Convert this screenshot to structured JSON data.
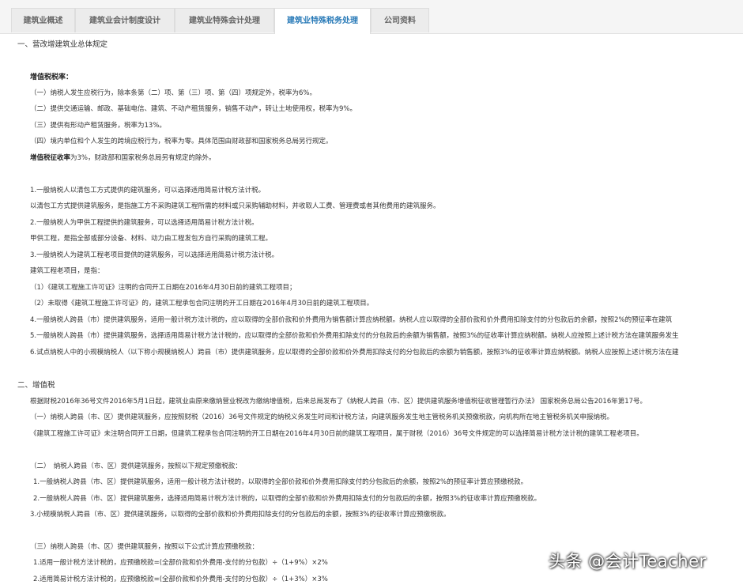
{
  "tabs": [
    {
      "label": "建筑业概述"
    },
    {
      "label": "建筑业会计制度设计"
    },
    {
      "label": "建筑业特殊会计处理"
    },
    {
      "label": "建筑业特殊税务处理"
    },
    {
      "label": "公司资料"
    }
  ],
  "active_tab": "建筑业特殊税务处理",
  "content": {
    "s1_heading": "一、营改增建筑业总体规定",
    "vat_rate_heading": "增值税税率：",
    "vat_rate_items": [
      "（一）纳税人发生应税行为，除本条第（二）项、第（三）项、第（四）项规定外，税率为6%。",
      "（二）提供交通运输、邮政、基础电信、建筑、不动产租赁服务，销售不动产，转让土地使用权，税率为9%。",
      "（三）提供有形动产租赁服务，税率为13%。",
      "（四）境内单位和个人发生的跨境应税行为，税率为零。具体范围由财政部和国家税务总局另行规定。"
    ],
    "levy_rate_bold": "增值税征收率",
    "levy_rate_rest": "为3%，财政部和国家税务总局另有规定的除外。",
    "simple_method_items": [
      "1.一般纳税人以清包工方式提供的建筑服务，可以选择适用简易计税方法计税。",
      "以清包工方式提供建筑服务，是指施工方不采购建筑工程所需的材料或只采购辅助材料，并收取人工费、管理费或者其他费用的建筑服务。",
      "2.一般纳税人为甲供工程提供的建筑服务，可以选择适用简易计税方法计税。",
      "甲供工程，是指全部或部分设备、材料、动力由工程发包方自行采购的建筑工程。",
      "3.一般纳税人为建筑工程老项目提供的建筑服务，可以选择适用简易计税方法计税。",
      "建筑工程老项目，是指：",
      "（1）《建筑工程施工许可证》注明的合同开工日期在2016年4月30日前的建筑工程项目；",
      "（2）未取得《建筑工程施工许可证》的，建筑工程承包合同注明的开工日期在2016年4月30日前的建筑工程项目。",
      "4.一般纳税人跨县（市）提供建筑服务，适用一般计税方法计税的，应以取得的全部价款和价外费用为销售额计算应纳税额。纳税人应以取得的全部价款和价外费用扣除支付的分包款后的余额，按照2%的预征率在建筑",
      "5.一般纳税人跨县（市）提供建筑服务，选择适用简易计税方法计税的，应以取得的全部价款和价外费用扣除支付的分包款后的余额为销售额，按照3%的征收率计算应纳税额。纳税人应按照上述计税方法在建筑服务发生",
      "6.试点纳税人中的小规模纳税人（以下称小规模纳税人）跨县（市）提供建筑服务，应以取得的全部价款和价外费用扣除支付的分包款后的余额为销售额，按照3%的征收率计算应纳税额。纳税人应按照上述计税方法在建"
    ],
    "s2_heading": "二、增值税",
    "s2_intro": "根据财税2016年36号文件2016年5月1日起，建筑业由原来缴纳营业税改为缴纳增值税，后来总局发布了《纳税人跨县（市、区）提供建筑服务增值税征收管理暂行办法》 国家税务总局公告2016年第17号。",
    "s2_p1": "（一）纳税人跨县（市、区）提供建筑服务，应按照财税（2016）36号文件规定的纳税义务发生时间和计税方法，向建筑服务发生地主管税务机关预缴税款，向机构所在地主管税务机关申报纳税。",
    "s2_p2": "《建筑工程施工许可证》未注明合同开工日期，但建筑工程承包合同注明的开工日期在2016年4月30日前的建筑工程项目，属于财税（2016）36号文件规定的可以选择简易计税方法计税的建筑工程老项目。",
    "s2_prepay_heading": "（二）　纳税人跨县（市、区）提供建筑服务，按照以下规定预缴税款：",
    "s2_prepay_items": [
      "1.一般纳税人跨县（市、区）提供建筑服务，适用一般计税方法计税的，以取得的全部价款和价外费用扣除支付的分包款后的余额，按照2%的预征率计算应预缴税款。",
      "2.一般纳税人跨县（市、区）提供建筑服务，选择适用简易计税方法计税的，以取得的全部价款和价外费用扣除支付的分包款后的余额，按照3%的征收率计算应预缴税款。",
      "3.小规模纳税人跨县（市、区）提供建筑服务，以取得的全部价款和价外费用扣除支付的分包款后的余额，按照3%的征收率计算应预缴税款。"
    ],
    "s2_formula_heading": "（三）纳税人跨县（市、区）提供建筑服务，按照以下公式计算应预缴税款：",
    "s2_formula_items": [
      "1.适用一般计税方法计税的，应预缴税款=(全部价款和价外费用-支付的分包款）÷（1+9%）×2%",
      "2.适用简易计税方法计税的，应预缴税款=(全部价款和价外费用-支付的分包款）÷（1+3%）×3%"
    ]
  },
  "watermark": "头条 @会计Teacher"
}
